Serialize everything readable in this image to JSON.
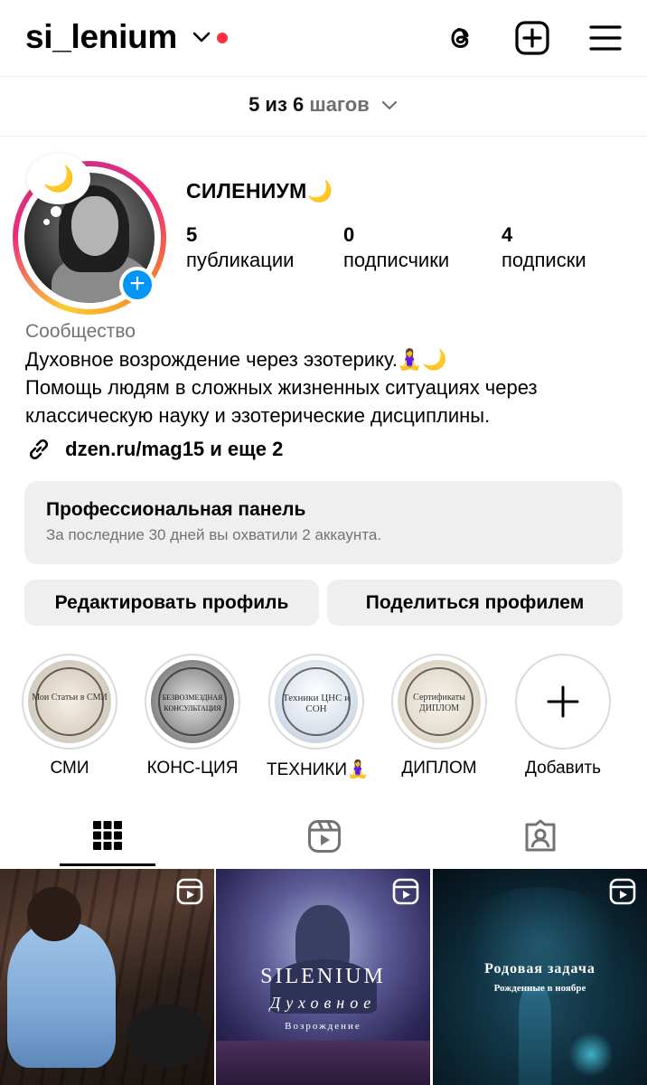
{
  "header": {
    "username": "si_lenium",
    "icons": [
      "threads-icon",
      "create-icon",
      "menu-icon"
    ]
  },
  "steps": {
    "progress": "5 из 6",
    "label": "шагов",
    "completed": 5,
    "total": 6
  },
  "profile": {
    "avatar_badge": "🌙",
    "display_name": "СИЛЕНИУМ🌙",
    "stats": [
      {
        "value": "5",
        "label": "публикации"
      },
      {
        "value": "0",
        "label": "подписчики"
      },
      {
        "value": "4",
        "label": "подписки"
      }
    ],
    "category": "Сообщество",
    "bio_line1": "Духовное возрождение через эзотерику.🧘‍♀️🌙",
    "bio_line2": "Помощь людям в сложных жизненных ситуациях через классическую науку и эзотерические дисциплины.",
    "link": "dzen.ru/mag15 и еще 2"
  },
  "pro_panel": {
    "title": "Профессиональная панель",
    "subtitle": "За последние 30 дней вы охватили 2 аккаунта."
  },
  "buttons": {
    "edit": "Редактировать профиль",
    "share": "Поделиться профилем"
  },
  "highlights": [
    {
      "label": "СМИ",
      "cover_text": "Мои Статьи в СМИ"
    },
    {
      "label": "КОНС-ЦИЯ",
      "cover_text": "БЕЗВОЗМЕЗДНАЯ КОНСУЛЬТАЦИЯ"
    },
    {
      "label": "ТЕХНИКИ🧘‍♀️",
      "cover_text": "Техники ЦНС и СОН"
    },
    {
      "label": "ДИПЛОМ",
      "cover_text": "Сертификаты ДИПЛОМ"
    },
    {
      "label": "Добавить"
    }
  ],
  "tabs": [
    "grid-tab",
    "reels-tab",
    "tagged-tab"
  ],
  "posts": [
    {
      "type": "reel"
    },
    {
      "type": "reel",
      "title": "SILENIUM",
      "subtitle": "Духовное",
      "caption": "Возрождение"
    },
    {
      "type": "reel",
      "title": "Родовая задача",
      "subtitle": "Рожденные в ноябре"
    }
  ],
  "colors": {
    "accent_blue": "#0095f6",
    "notification_red": "#ff3040",
    "muted_text": "#737373",
    "panel_bg": "#efefef"
  }
}
